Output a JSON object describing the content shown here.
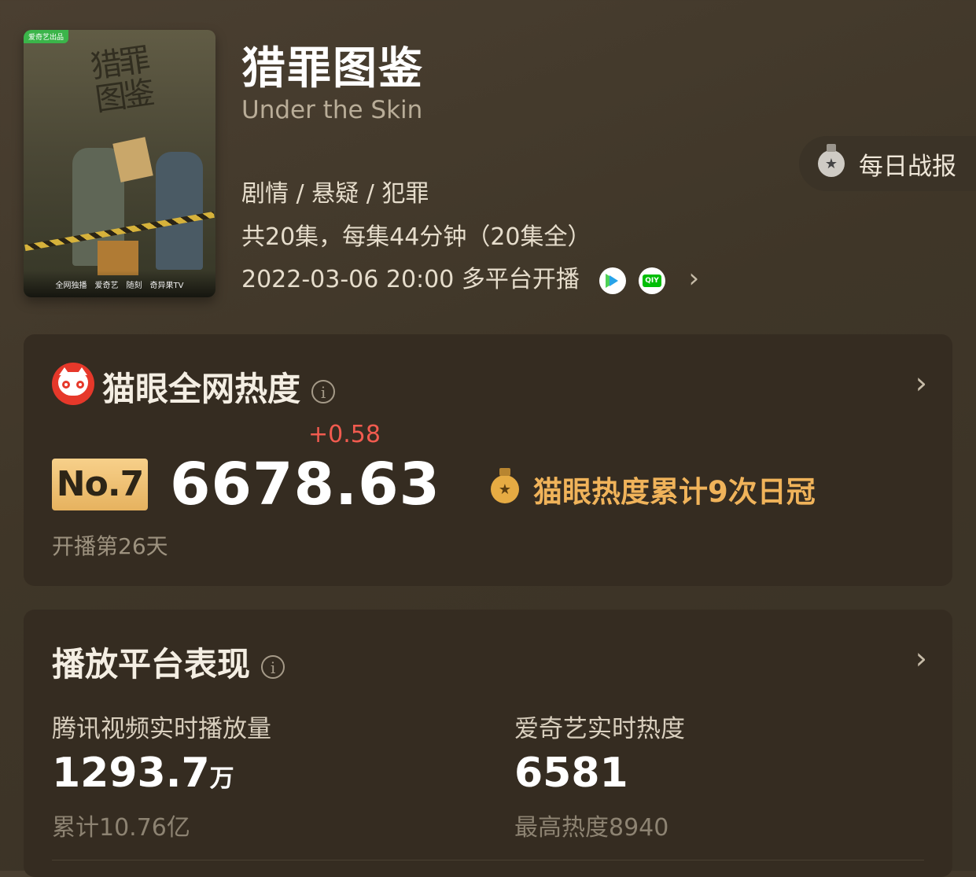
{
  "show": {
    "title_zh": "猎罪图鉴",
    "title_en": "Under the Skin",
    "genres": "剧情 / 悬疑 / 犯罪",
    "episodes": "共20集，每集44分钟（20集全）",
    "premiere": "2022-03-06 20:00 多平台开播",
    "platform_icons": [
      "tencent-video-icon",
      "iqiyi-icon"
    ],
    "poster": {
      "badge": "爱奇艺出品",
      "calligraphy": "猎罪图鉴",
      "logos": [
        "全网独播",
        "爱奇艺",
        "随刻",
        "奇异果TV"
      ]
    }
  },
  "daily_report": {
    "label": "每日战报",
    "icon": "medal-icon"
  },
  "maoyan": {
    "title": "猫眼全网热度",
    "info_icon": "i",
    "rank": "No.7",
    "score": "6678.63",
    "delta": "+0.58",
    "days": "开播第26天",
    "crown_text": "猫眼热度累计9次日冠"
  },
  "platforms": {
    "title": "播放平台表现",
    "info_icon": "i",
    "tencent": {
      "label": "腾讯视频实时播放量",
      "value": "1293.7",
      "unit": "万",
      "sub": "累计10.76亿"
    },
    "iqiyi": {
      "label": "爱奇艺实时热度",
      "value": "6581",
      "sub": "最高热度8940"
    }
  },
  "chevron": "›",
  "colors": {
    "accent_gold": "#f0b35a",
    "delta_red": "#f25b4f",
    "maoyan_red": "#e6382a",
    "card_bg": "#352c21"
  }
}
